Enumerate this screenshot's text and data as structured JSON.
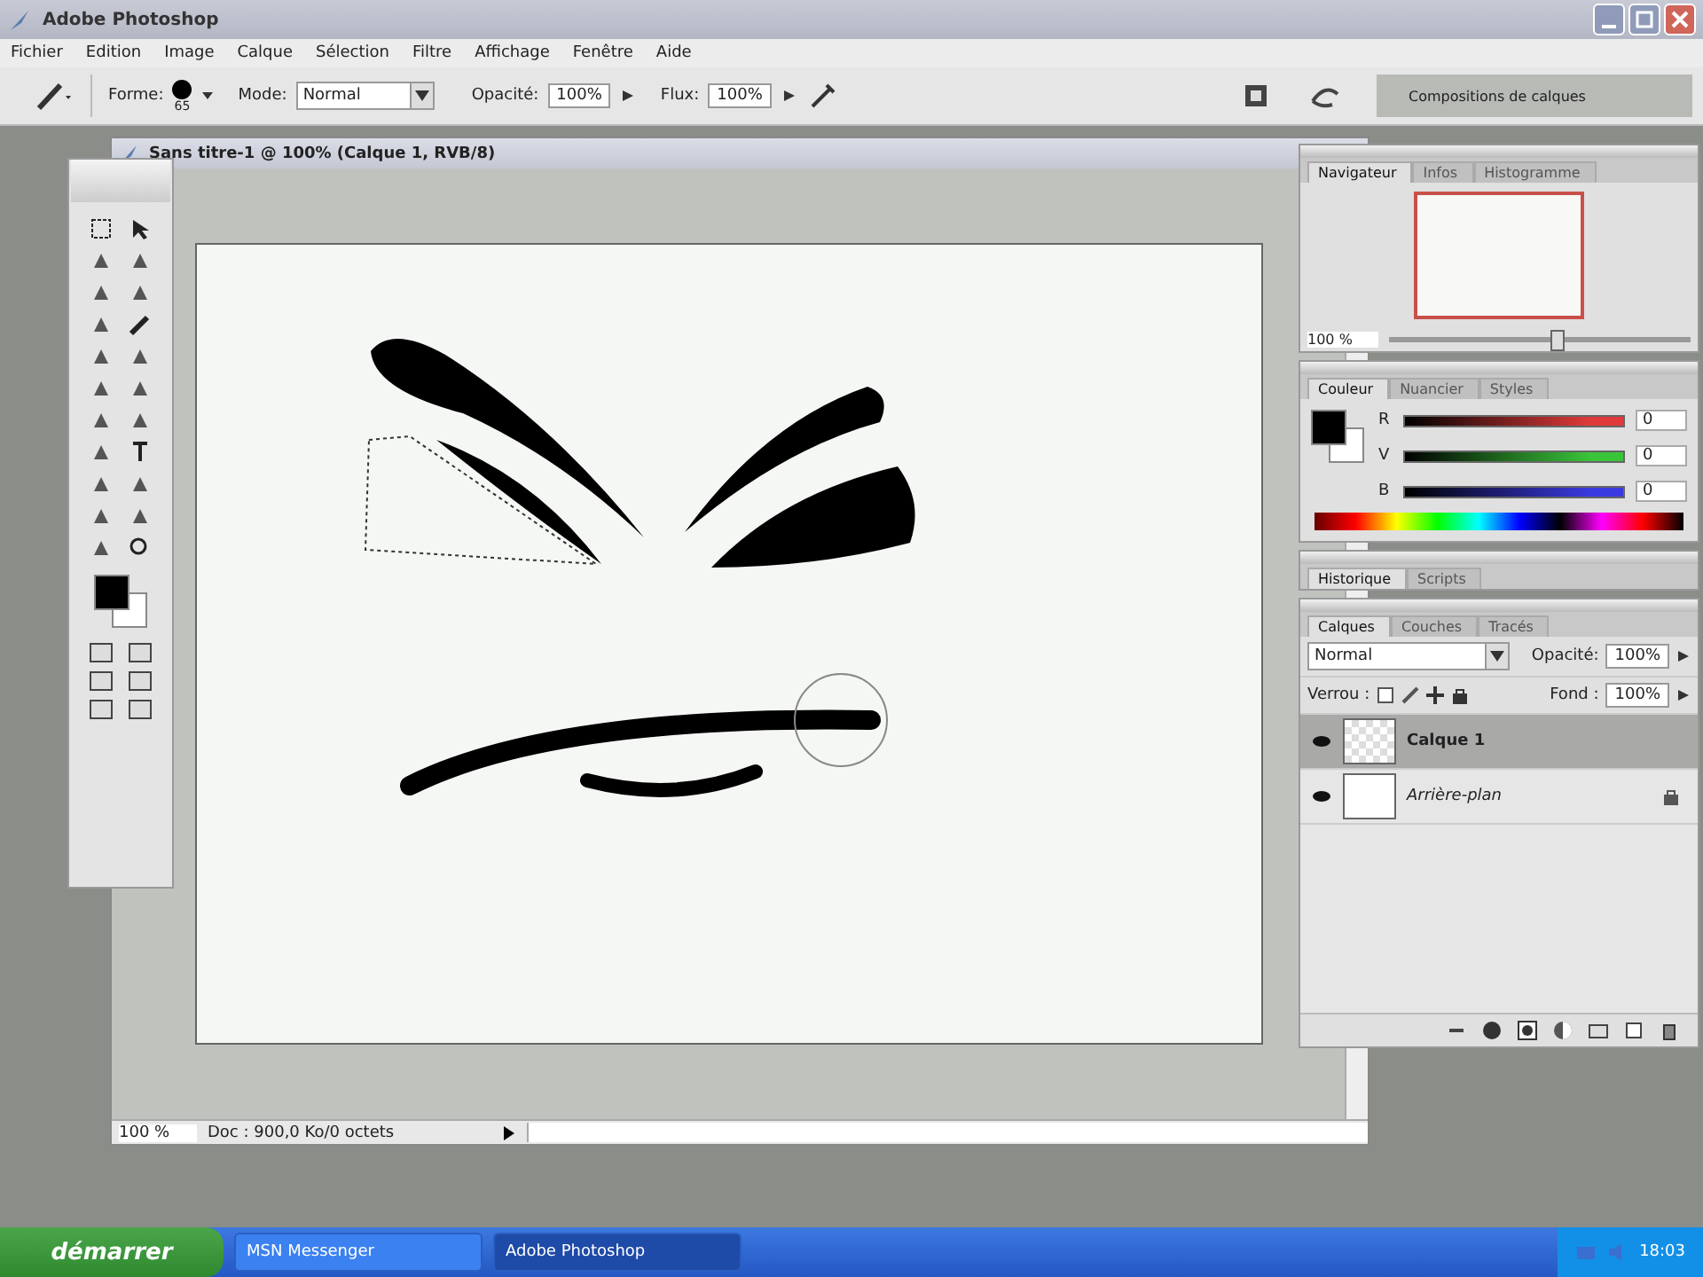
{
  "window": {
    "title": "Adobe Photoshop"
  },
  "menu": [
    "Fichier",
    "Edition",
    "Image",
    "Calque",
    "Sélection",
    "Filtre",
    "Affichage",
    "Fenêtre",
    "Aide"
  ],
  "options_bar": {
    "shape_label": "Forme:",
    "brush_size": "65",
    "mode_label": "Mode:",
    "mode": "Normal",
    "opacity_label": "Opacité:",
    "opacity": "100%",
    "flow_label": "Flux:",
    "flow": "100%",
    "palette_well_tab": "Compositions de calques"
  },
  "document": {
    "title": "Sans titre-1 @ 100% (Calque 1, RVB/8)",
    "zoom": "100 %",
    "status": "Doc : 900,0 Ko/0 octets"
  },
  "navigator": {
    "tabs": [
      {
        "label": "Navigateur",
        "selected": true
      },
      {
        "label": "Infos",
        "selected": false
      },
      {
        "label": "Histogramme",
        "selected": false
      }
    ],
    "zoom": "100 %",
    "level": 0.55
  },
  "color": {
    "tabs": [
      {
        "label": "Couleur",
        "selected": true
      },
      {
        "label": "Nuancier",
        "selected": false
      },
      {
        "label": "Styles",
        "selected": false
      }
    ],
    "channels": [
      {
        "label": "R",
        "value": "0",
        "color": "#e03a3a"
      },
      {
        "label": "V",
        "value": "0",
        "color": "#3ac43a"
      },
      {
        "label": "B",
        "value": "0",
        "color": "#3a3ae0"
      }
    ]
  },
  "history": {
    "tabs": [
      {
        "label": "Historique",
        "selected": true
      },
      {
        "label": "Scripts",
        "selected": false
      }
    ]
  },
  "layers": {
    "tabs": [
      {
        "label": "Calques",
        "selected": true
      },
      {
        "label": "Couches",
        "selected": false
      },
      {
        "label": "Tracés",
        "selected": false
      }
    ],
    "blend_mode": "Normal",
    "opacity_label": "Opacité:",
    "opacity": "100%",
    "lock_label": "Verrou :",
    "fill_label": "Fond :",
    "fill": "100%",
    "items": [
      {
        "name": "Calque 1",
        "selected": true,
        "visible": true,
        "locked": false,
        "kind": "transparent"
      },
      {
        "name": "Arrière-plan",
        "selected": false,
        "visible": true,
        "locked": true,
        "kind": "white"
      }
    ]
  },
  "taskbar": {
    "start": "démarrer",
    "tasks": [
      {
        "label": "MSN Messenger",
        "selected": false
      },
      {
        "label": "Adobe Photoshop",
        "selected": true
      }
    ],
    "clock": "18:03"
  }
}
